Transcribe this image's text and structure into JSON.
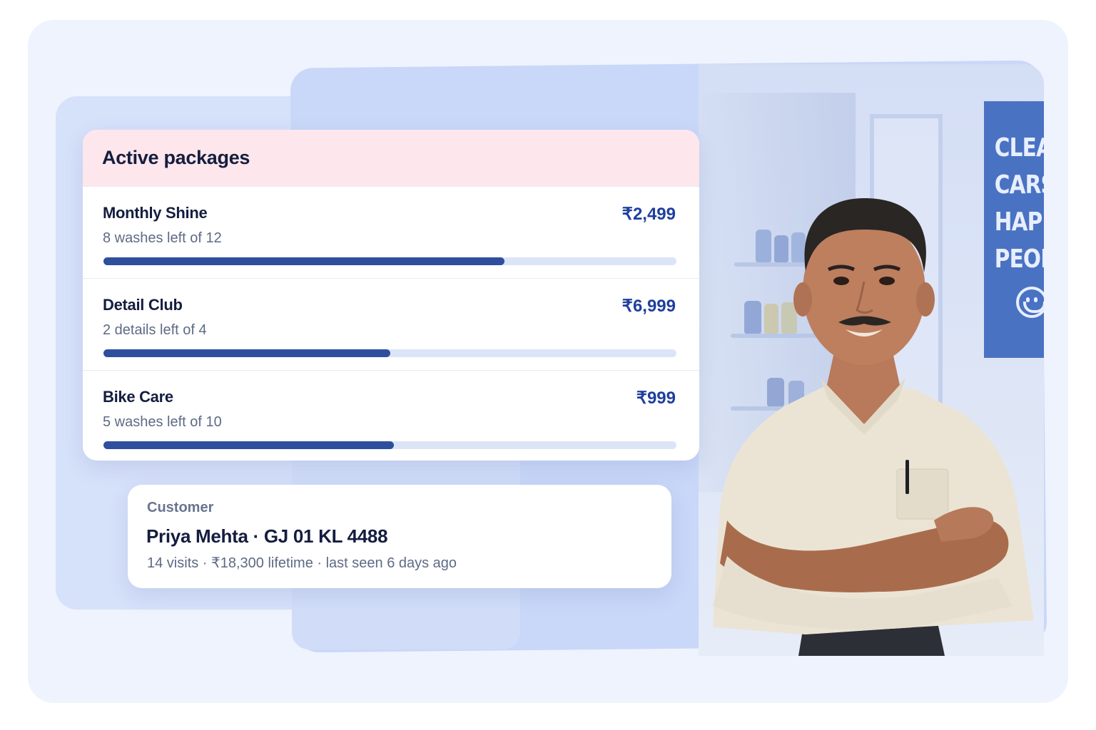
{
  "packages_card": {
    "title": "Active packages",
    "items": [
      {
        "name": "Monthly Shine",
        "price": "₹2,499",
        "usage": "8 washes left of 12",
        "progress": 0.7
      },
      {
        "name": "Detail Club",
        "price": "₹6,999",
        "usage": "2 details left of 4",
        "progress": 0.5
      },
      {
        "name": "Bike Care",
        "price": "₹999",
        "usage": "5 washes left of 10",
        "progress": 0.507
      }
    ]
  },
  "customer_card": {
    "label": "Customer",
    "name_plate": "Priya Mehta · GJ 01 KL 4488",
    "summary": "14 visits · ₹18,300 lifetime · last seen 6 days ago"
  },
  "background_sign": {
    "lines": [
      "CLEAN",
      "CARS",
      "HAPPY",
      "PEOPLE"
    ],
    "icon": "smiley-icon"
  },
  "colors": {
    "accent": "#2f4f9e",
    "price": "#1f3f9e",
    "header_pink": "#fde6ec",
    "track": "#dce5f8",
    "frame_bg": "#eef3fd",
    "sign_blue": "#4a72c2"
  }
}
